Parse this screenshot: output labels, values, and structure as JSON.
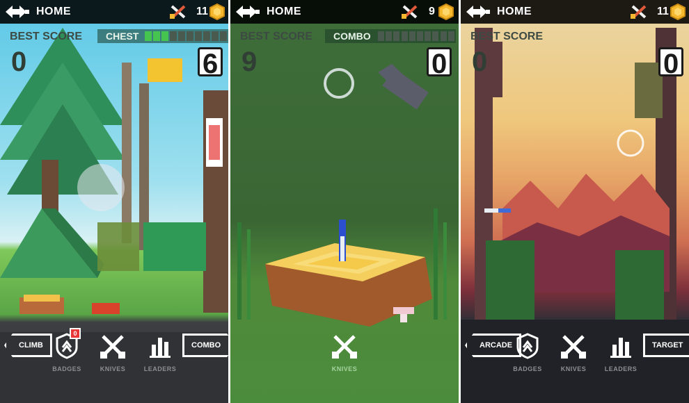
{
  "screens": [
    {
      "home_label": "HOME",
      "knives_count": "11",
      "best_score_label": "BEST SCORE",
      "meter_label": "CHEST",
      "meter_filled": 3,
      "meter_total": 10,
      "best_score": "0",
      "current_score": "6",
      "left_button": "CLIMB",
      "right_button": "COMBO",
      "nav": [
        {
          "label": "BADGES",
          "icon": "shield-icon",
          "badge": "0"
        },
        {
          "label": "KNIVES",
          "icon": "crossed-knives-icon"
        },
        {
          "label": "LEADERS",
          "icon": "bar-chart-icon"
        }
      ]
    },
    {
      "home_label": "HOME",
      "knives_count": "9",
      "best_score_label": "BEST SCORE",
      "meter_label": "COMBO",
      "meter_filled": 0,
      "meter_total": 10,
      "best_score": "9",
      "current_score": "0",
      "nav": [
        {
          "label": "KNIVES",
          "icon": "crossed-knives-icon"
        }
      ]
    },
    {
      "home_label": "HOME",
      "knives_count": "11",
      "best_score_label": "BEST SCORE",
      "best_score": "0",
      "current_score": "0",
      "left_button": "ARCADE",
      "right_button": "TARGET",
      "nav": [
        {
          "label": "BADGES",
          "icon": "shield-icon"
        },
        {
          "label": "KNIVES",
          "icon": "crossed-knives-icon"
        },
        {
          "label": "LEADERS",
          "icon": "bar-chart-icon"
        }
      ]
    }
  ],
  "colors": {
    "topbar": "#000000",
    "coin": "#f5b82e",
    "meter_on": "#45c54f",
    "badge_alert": "#e83737"
  }
}
